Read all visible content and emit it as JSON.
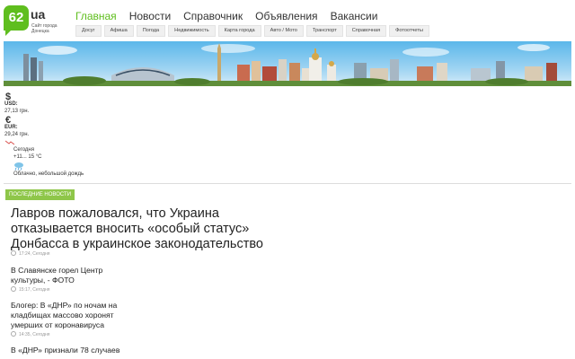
{
  "site": {
    "logo_number": "62",
    "logo_suffix": "ua",
    "logo_tagline": "Сайт города Донецка"
  },
  "main_nav": [
    {
      "label": "Главная",
      "active": true
    },
    {
      "label": "Новости",
      "active": false
    },
    {
      "label": "Справочник",
      "active": false
    },
    {
      "label": "Объявления",
      "active": false
    },
    {
      "label": "Вакансии",
      "active": false
    }
  ],
  "sub_nav": [
    "Досуг",
    "Афиша",
    "Погода",
    "Недвижимость",
    "Карта города",
    "Авто / Мото",
    "Транспорт",
    "Справочная",
    "Фотоотчеты"
  ],
  "currency": {
    "usd_symbol": "$",
    "usd_label": "USD:",
    "usd_value": "27,13 грн.",
    "eur_symbol": "€",
    "eur_label": "EUR:",
    "eur_value": "29,24 грн."
  },
  "weather": {
    "day": "Сегодня",
    "temp": "+11... 15 °C",
    "condition": "Облачно, небольшой дождь",
    "icon": "cloud-rain-icon"
  },
  "news": {
    "section_label": "Последние новости",
    "lead": {
      "title": "Лавров пожаловался, что Украина отказывается вносить «особый статус» Донбасса в украинское законодательство",
      "time": "17:24, Сегодня"
    },
    "items": [
      {
        "title": "В Славянске горел Центр культуры, - ФОТО",
        "time": "15:17, Сегодня"
      },
      {
        "title": "Блогер: В «ДНР» по ночам на кладбищах массово хоронят умерших от коронавируса",
        "time": "14:35, Сегодня"
      },
      {
        "title": "В «ДНР» признали 78 случаев",
        "time": ""
      }
    ]
  },
  "colors": {
    "brand": "#5fbe1e",
    "badge": "#8ec649"
  }
}
